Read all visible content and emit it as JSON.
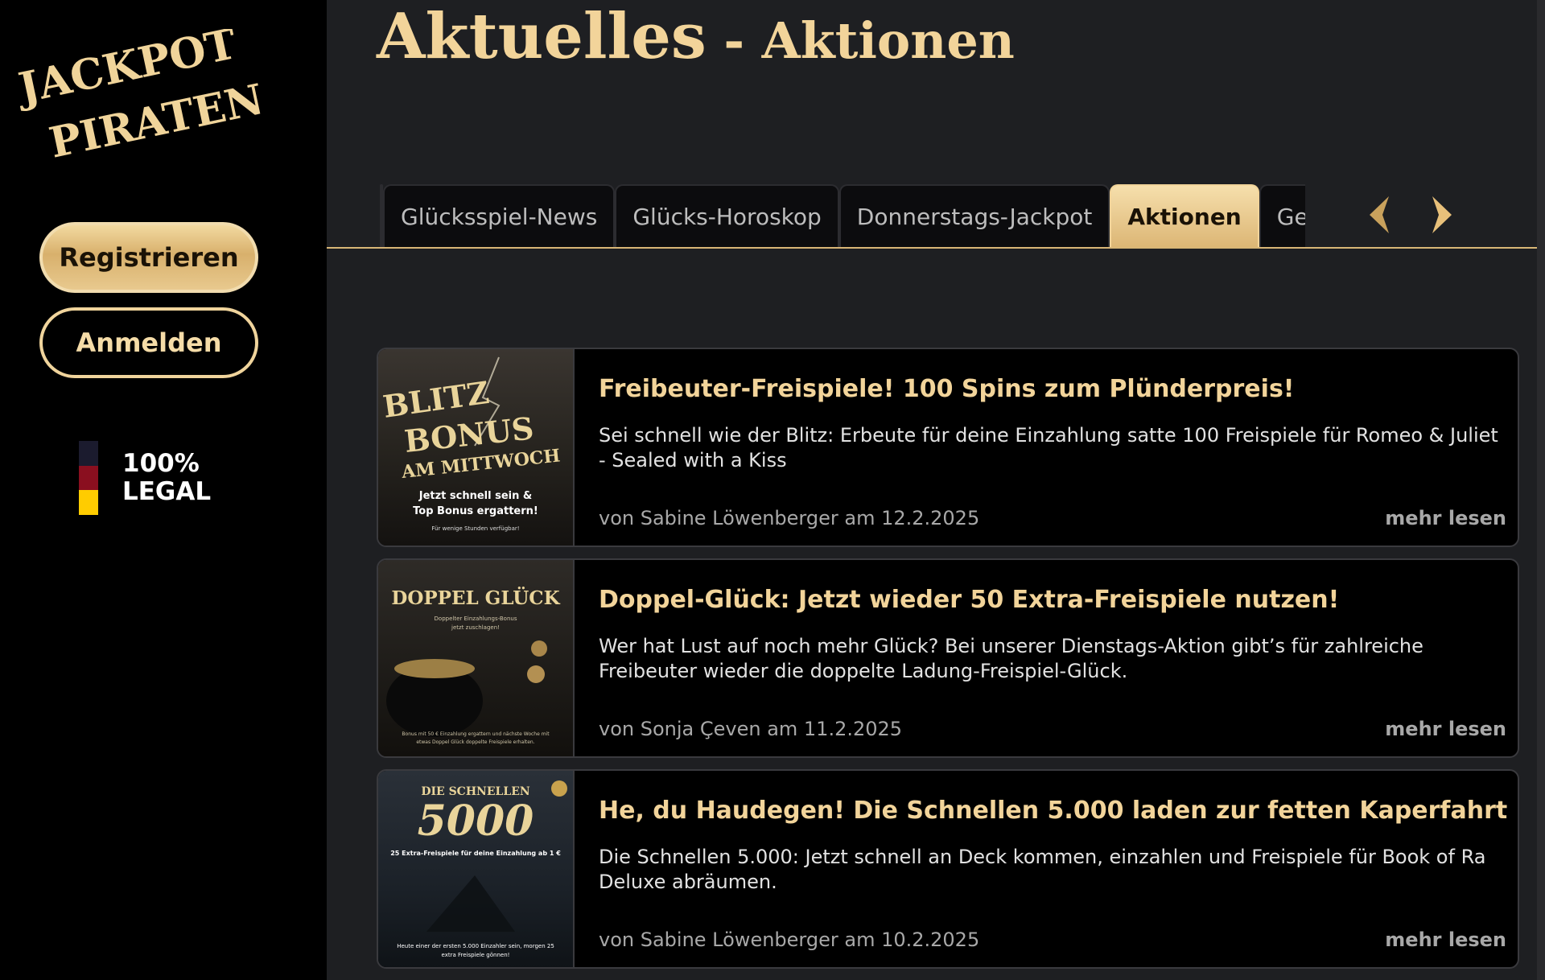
{
  "brand": {
    "logo_line1": "JACKPOT",
    "logo_line2": "PIRATEN"
  },
  "sidebar": {
    "register_label": "Registrieren",
    "login_label": "Anmelden",
    "legal_line1": "100%",
    "legal_line2": "LEGAL",
    "flag_colors": [
      "#1b1b2e",
      "#8a0f1f",
      "#ffcc00"
    ]
  },
  "header": {
    "title_main": "Aktuelles",
    "title_sep": " - ",
    "title_sub": "Aktionen"
  },
  "tabs": [
    {
      "label": ""
    },
    {
      "label": "Glücksspiel-News"
    },
    {
      "label": "Glücks-Horoskop"
    },
    {
      "label": "Donnerstags-Jackpot"
    },
    {
      "label": "Aktionen",
      "active": true
    },
    {
      "label": "Gewi"
    }
  ],
  "articles": [
    {
      "title": "Freibeuter-Freispiele! 100 Spins zum Plünderpreis!",
      "description": "Sei schnell wie der Blitz: Erbeute für deine Einzahlung satte 100 Freispiele für Romeo & Juliet - Sealed with a Kiss",
      "meta": "von Sabine Löwenberger am 12.2.2025",
      "more": "mehr lesen",
      "image": {
        "line1": "BLITZ",
        "line2": "BONUS",
        "line3": "AM MITTWOCH",
        "line4": "Jetzt schnell sein &",
        "line5": "Top Bonus ergattern!",
        "line6": "Für wenige Stunden verfügbar!"
      }
    },
    {
      "title": "Doppel-Glück: Jetzt wieder 50 Extra-Freispiele nutzen!",
      "description": "Wer hat Lust auf noch mehr Glück? Bei unserer Dienstags-Aktion gibt’s für zahlreiche Freibeuter wieder die doppelte Ladung-Freispiel-Glück.",
      "meta": "von Sonja Çeven am 11.2.2025",
      "more": "mehr lesen",
      "image": {
        "line1": "DOPPEL GLÜCK",
        "line2": "Doppelter Einzahlungs-Bonus",
        "line3": "jetzt zuschlagen!",
        "line4": "Bonus mit 50 € Einzahlung ergattern und nächste Woche mit",
        "line5": "etwas Doppel Glück doppelte Freispiele erhalten."
      }
    },
    {
      "title": "He, du Haudegen! Die Schnellen 5.000 laden zur fetten Kaperfahrt",
      "description": "Die Schnellen 5.000: Jetzt schnell an Deck kommen, einzahlen und Freispiele für Book of Ra Deluxe abräumen.",
      "meta": "von Sabine Löwenberger am 10.2.2025",
      "more": "mehr lesen",
      "image": {
        "line1": "DIE SCHNELLEN",
        "line2": "5000",
        "line3": "25 Extra-Freispiele für deine Einzahlung ab 1 €",
        "line4": "Heute einer der ersten 5.000 Einzahler sein, morgen 25",
        "line5": "extra Freispiele gönnen!"
      }
    }
  ]
}
